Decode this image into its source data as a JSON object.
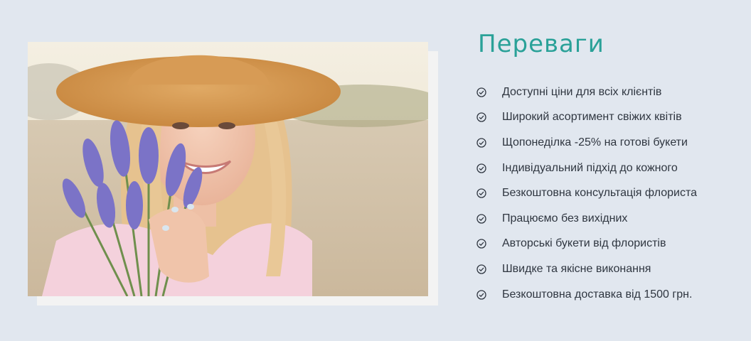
{
  "section": {
    "title": "Переваги",
    "photo": {
      "description_icon": "woman-with-lavender-photo"
    },
    "benefits": [
      {
        "icon": "check-circle-icon",
        "label": "Доступні ціни для всіх клієнтів"
      },
      {
        "icon": "check-circle-icon",
        "label": "Широкий асортимент свіжих квітів"
      },
      {
        "icon": "check-circle-icon",
        "label": "Щопонеділка -25% на готові букети"
      },
      {
        "icon": "check-circle-icon",
        "label": "Індивідуальний підхід до кожного"
      },
      {
        "icon": "check-circle-icon",
        "label": "Безкоштовна консультація флориста"
      },
      {
        "icon": "check-circle-icon",
        "label": "Працюємо без вихідних"
      },
      {
        "icon": "check-circle-icon",
        "label": "Авторські букети від флористів"
      },
      {
        "icon": "check-circle-icon",
        "label": "Швидке та якісне виконання"
      },
      {
        "icon": "check-circle-icon",
        "label": "Безкоштовна доставка від 1500 грн."
      }
    ]
  },
  "colors": {
    "background": "#e1e7ef",
    "title": "#2aa198",
    "text": "#2f3640",
    "frame": "#f3f3f3"
  }
}
